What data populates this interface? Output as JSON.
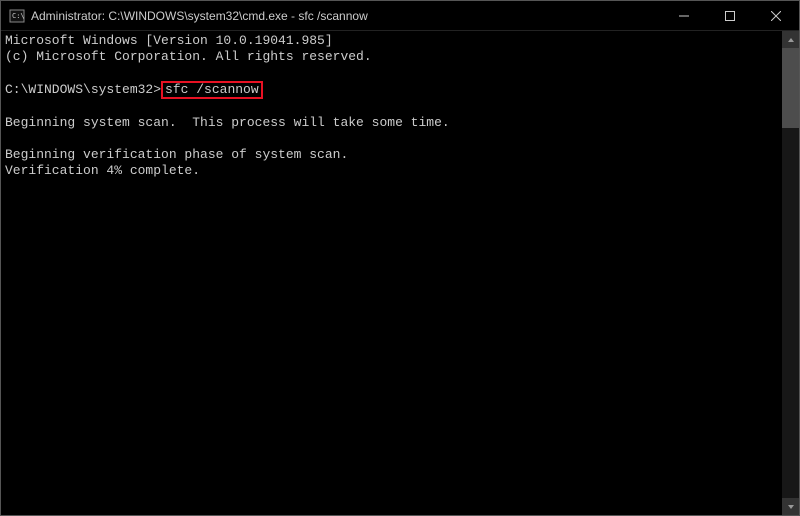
{
  "titlebar": {
    "title": "Administrator: C:\\WINDOWS\\system32\\cmd.exe - sfc  /scannow"
  },
  "terminal": {
    "version_line": "Microsoft Windows [Version 10.0.19041.985]",
    "copyright_line": "(c) Microsoft Corporation. All rights reserved.",
    "prompt": "C:\\WINDOWS\\system32>",
    "command": "sfc /scannow",
    "scan_start": "Beginning system scan.  This process will take some time.",
    "verify_phase": "Beginning verification phase of system scan.",
    "verify_progress": "Verification 4% complete."
  }
}
